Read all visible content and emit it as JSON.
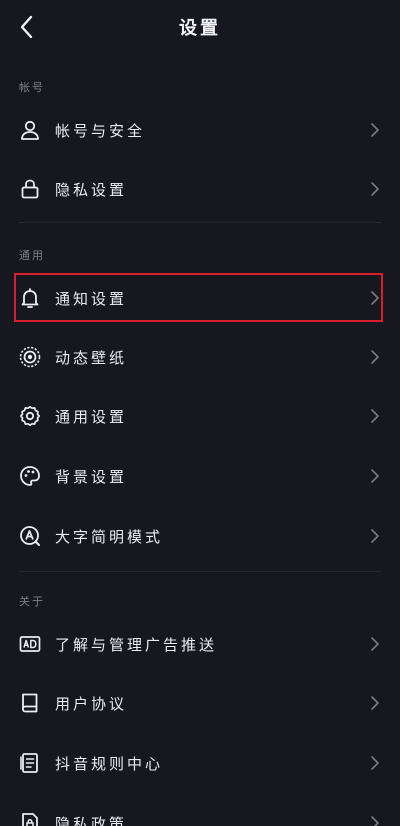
{
  "header": {
    "title": "设置",
    "back_icon": "chevron-left-icon"
  },
  "sections": {
    "account": {
      "label": "帐号"
    },
    "general": {
      "label": "通用"
    },
    "about": {
      "label": "关于"
    }
  },
  "rows": {
    "account_security": {
      "label": "帐号与安全",
      "icon": "person-icon"
    },
    "privacy_settings": {
      "label": "隐私设置",
      "icon": "lock-icon"
    },
    "notification_settings": {
      "label": "通知设置",
      "icon": "bell-icon"
    },
    "live_wallpaper": {
      "label": "动态壁纸",
      "icon": "wallpaper-icon"
    },
    "general_settings": {
      "label": "通用设置",
      "icon": "gear-icon"
    },
    "background_settings": {
      "label": "背景设置",
      "icon": "palette-icon"
    },
    "large_text_mode": {
      "label": "大字简明模式",
      "icon": "large-text-icon"
    },
    "ad_management": {
      "label": "了解与管理广告推送",
      "icon": "ad-icon"
    },
    "user_agreement": {
      "label": "用户协议",
      "icon": "book-icon"
    },
    "community_rules": {
      "label": "抖音规则中心",
      "icon": "rules-document-icon"
    },
    "privacy_policy": {
      "label": "隐私政策",
      "icon": "privacy-document-icon"
    }
  },
  "colors": {
    "background": "#16171f",
    "text": "#ececf1",
    "section_label": "#7d7e88",
    "highlight_border": "#d91f2b"
  }
}
